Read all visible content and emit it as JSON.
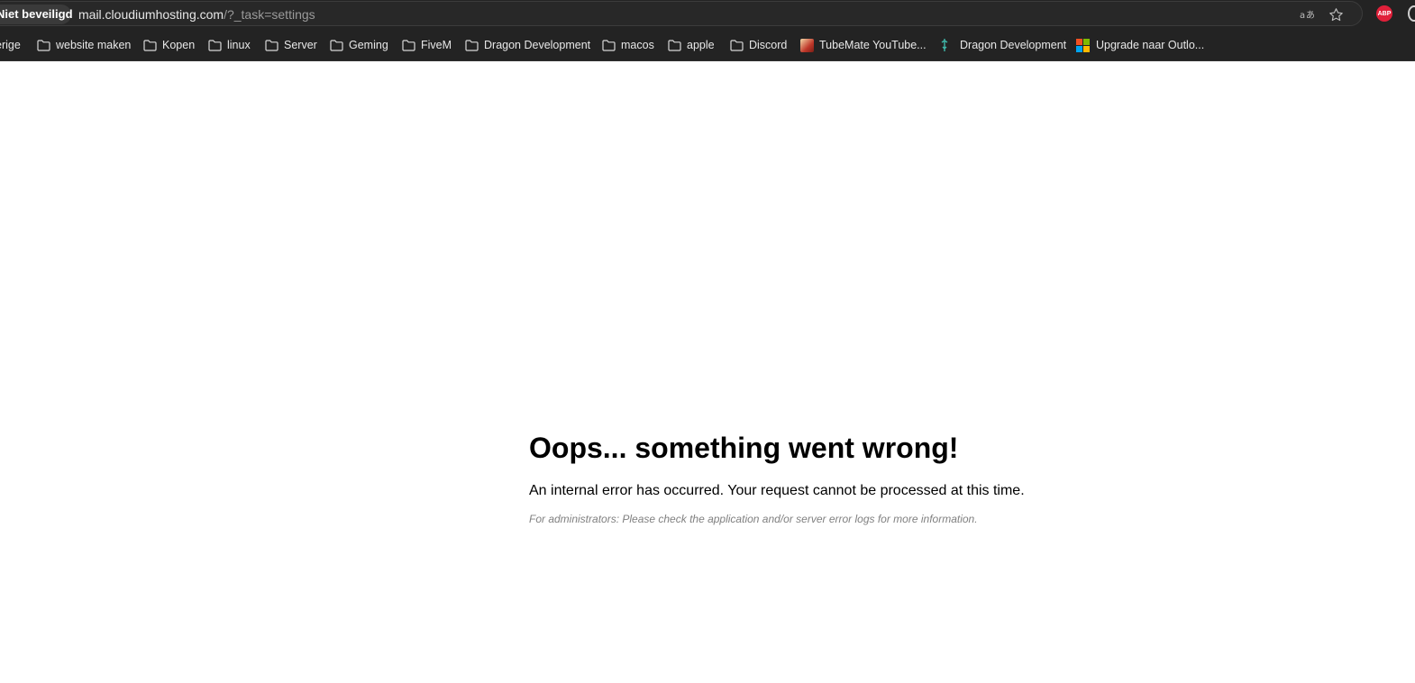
{
  "address_bar": {
    "security_label": "Niet beveiligd",
    "url_host": "mail.cloudiumhosting.com",
    "url_path": "/?_task=settings",
    "icons": [
      "translate-icon",
      "star-icon"
    ]
  },
  "extensions": {
    "adblock_label": "ABP"
  },
  "bookmarks": [
    {
      "label": "erige",
      "icon": "folder-icon"
    },
    {
      "label": "website maken",
      "icon": "folder-icon"
    },
    {
      "label": "Kopen",
      "icon": "folder-icon"
    },
    {
      "label": "linux",
      "icon": "folder-icon"
    },
    {
      "label": "Server",
      "icon": "folder-icon"
    },
    {
      "label": "Geming",
      "icon": "folder-icon"
    },
    {
      "label": "FiveM",
      "icon": "folder-icon"
    },
    {
      "label": "Dragon Development",
      "icon": "folder-icon"
    },
    {
      "label": "macos",
      "icon": "folder-icon"
    },
    {
      "label": "apple",
      "icon": "folder-icon"
    },
    {
      "label": "Discord",
      "icon": "folder-icon"
    },
    {
      "label": "TubeMate YouTube...",
      "icon": "tubemate-icon"
    },
    {
      "label": "Dragon Development",
      "icon": "dragon-icon"
    },
    {
      "label": "Upgrade naar Outlo...",
      "icon": "microsoft-icon"
    }
  ],
  "error": {
    "title": "Oops... something went wrong!",
    "message": "An internal error has occurred. Your request cannot be processed at this time.",
    "hint": "For administrators: Please check the application and/or server error logs for more information."
  }
}
